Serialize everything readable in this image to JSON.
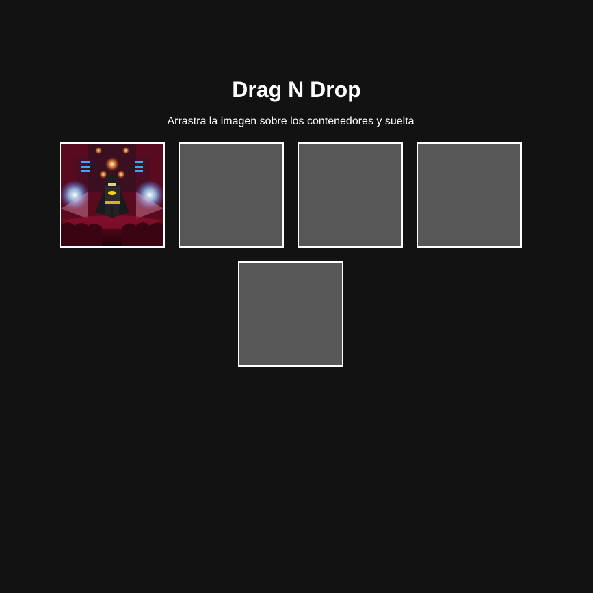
{
  "header": {
    "title": "Drag N Drop",
    "subtitle": "Arrastra la imagen sobre los contenedores y suelta"
  },
  "containers": [
    {
      "id": "box1",
      "has_image": true
    },
    {
      "id": "box2",
      "has_image": false
    },
    {
      "id": "box3",
      "has_image": false
    },
    {
      "id": "box4",
      "has_image": false
    },
    {
      "id": "box5",
      "has_image": false
    }
  ],
  "image": {
    "subject": "batman-lego-poster"
  },
  "colors": {
    "background": "#121212",
    "container_fill": "#575757",
    "container_border": "#ffffff",
    "text": "#ffffff"
  }
}
